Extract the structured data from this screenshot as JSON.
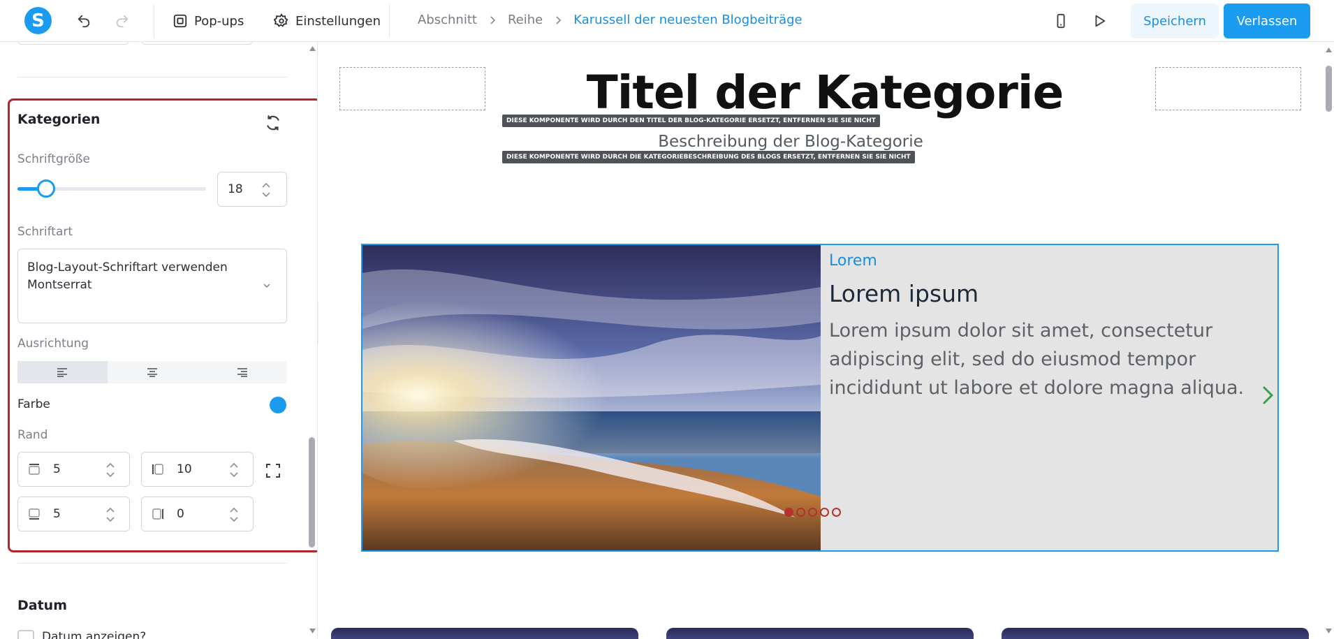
{
  "app": {
    "logo_letter": "S",
    "accent_color": "#1a9bf0"
  },
  "topbar": {
    "undo_icon": "undo-icon",
    "redo_icon": "redo-icon",
    "popups_label": "Pop-ups",
    "settings_label": "Einstellungen",
    "breadcrumb": [
      "Abschnitt",
      "Reihe",
      "Karussell der neuesten Blogbeiträge"
    ],
    "mobile_icon": "mobile-preview-icon",
    "play_icon": "play-preview-icon",
    "save_label": "Speichern",
    "exit_label": "Verlassen"
  },
  "panel": {
    "section_title": "Kategorien",
    "reset_icon": "refresh-icon",
    "font_size_label": "Schriftgröße",
    "font_size_value": "18",
    "font_size_slider_fraction": 0.15,
    "font_label": "Schriftart",
    "font_value_line1": "Blog-Layout-Schriftart verwenden",
    "font_value_line2": "Montserrat",
    "alignment_label": "Ausrichtung",
    "alignment_options": [
      "align-left-icon",
      "align-center-icon",
      "align-right-icon"
    ],
    "alignment_selected": "left",
    "color_label": "Farbe",
    "color_value": "#1a9bf0",
    "border_label": "Rand",
    "border_top": "5",
    "border_left": "10",
    "border_bottom": "5",
    "border_right": "0",
    "next_section_title": "Datum",
    "date_checkbox_label": "Datum anzeigen?"
  },
  "canvas": {
    "category_title": "Titel der Kategorie",
    "title_notice": "DIESE KOMPONENTE WIRD DURCH DEN TITEL DER BLOG-KATEGORIE ERSETZT, ENTFERNEN SIE SIE NICHT",
    "category_description": "Beschreibung der Blog-Kategorie",
    "description_notice": "DIESE KOMPONENTE WIRD DURCH DIE KATEGORIEBESCHREIBUNG DES BLOGS ERSETZT, ENTFERNEN SIE SIE NICHT",
    "card": {
      "category": "Lorem",
      "title": "Lorem ipsum",
      "excerpt": "Lorem ipsum dolor sit amet, consectetur adipiscing elit, sed do eiusmod tempor incididunt ut labore et dolore magna aliqua.",
      "dots_total": 5,
      "dots_active": 1
    }
  }
}
